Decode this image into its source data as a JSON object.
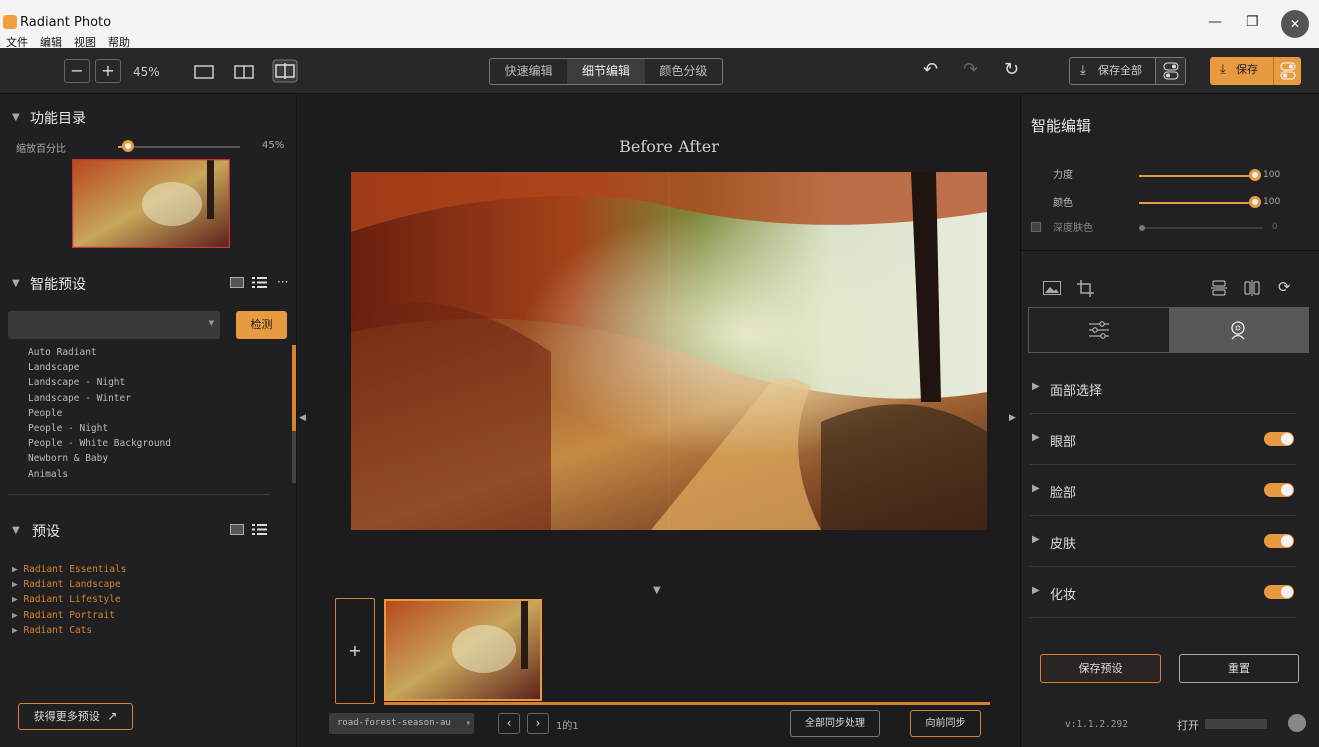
{
  "window": {
    "title": "Radiant Photo"
  },
  "menu": [
    "文件",
    "编辑",
    "视图",
    "帮助"
  ],
  "toolbar": {
    "zoom_minus": "−",
    "zoom_plus": "+",
    "zoom_value": "45%",
    "modes": [
      "快速编辑",
      "细节编辑",
      "颜色分级"
    ],
    "active_mode": "细节编辑",
    "save_all_label": "保存全部",
    "save_label": "保存",
    "accent": "#e89a40"
  },
  "left": {
    "catalog_title": "功能目录",
    "zoom_label": "缩放百分比",
    "zoom_value": "45%",
    "zoom_level": 0.11,
    "smart_presets_title": "智能预设",
    "detect_label": "检测",
    "smart_presets": [
      "Auto Radiant",
      "Landscape",
      "Landscape - Night",
      "Landscape - Winter",
      "People",
      "People - Night",
      "People - White Background",
      "Newborn & Baby",
      "Animals"
    ],
    "presets_title": "预设",
    "presets": [
      "Radiant Essentials",
      "Radiant Landscape",
      "Radiant Lifestyle",
      "Radiant Portrait",
      "Radiant Cats"
    ],
    "more_presets_label": "获得更多预设"
  },
  "center": {
    "compare_label": "Before After",
    "add_label": "+",
    "filename": "road-forest-season-au",
    "page_info": "1的1",
    "sync_all_label": "全部同步处理",
    "sync_label": "向前同步"
  },
  "right": {
    "smart_edit_title": "智能编辑",
    "sliders": [
      {
        "label": "力度",
        "value": "100",
        "level": 1.0
      },
      {
        "label": "颜色",
        "value": "100",
        "level": 1.0
      },
      {
        "label": "深度肤色",
        "value": "0",
        "level": 0.0
      }
    ],
    "sections": [
      {
        "label": "面部选择",
        "toggle": false
      },
      {
        "label": "眼部",
        "toggle": true
      },
      {
        "label": "脸部",
        "toggle": true
      },
      {
        "label": "皮肤",
        "toggle": true
      },
      {
        "label": "化妆",
        "toggle": true
      }
    ],
    "save_preset_label": "保存预设",
    "reset_label": "重置",
    "version": "v:1.1.2.292",
    "open_label": "打开"
  }
}
